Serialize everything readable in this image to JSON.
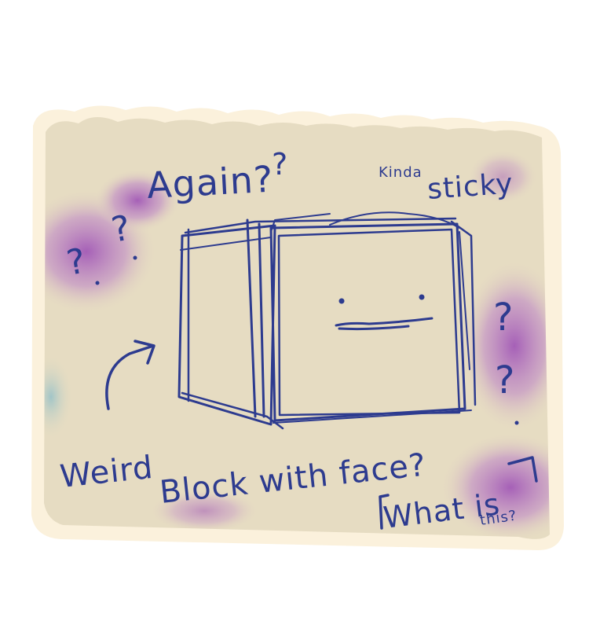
{
  "sketch": {
    "texts": {
      "again": "Again?",
      "kinda": "Kinda",
      "sticky": "sticky",
      "weird": "Weird",
      "block_with_face": "Block with face?",
      "what_is": "What is",
      "this": "this?"
    },
    "question_marks": {
      "q1": "?",
      "q2": "?",
      "q3": "?",
      "q4": "?",
      "q5": "?"
    },
    "palette": {
      "paper": "#e6dcc2",
      "paper_border": "#fbf1dc",
      "ink": "#2d3b8f",
      "purple_wash": "#9a4ab5",
      "teal_wash": "#8fbfc9"
    }
  }
}
